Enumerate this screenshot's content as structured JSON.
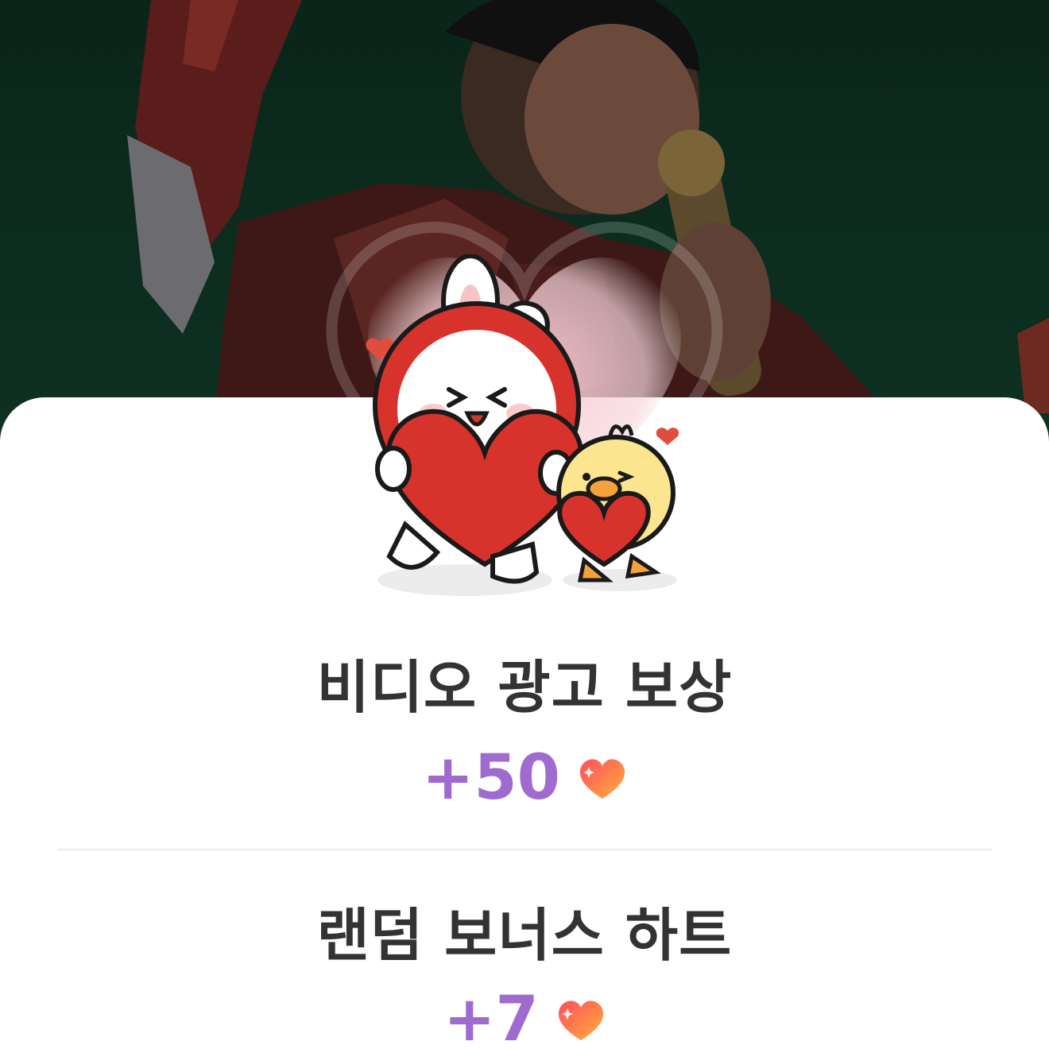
{
  "rewards": [
    {
      "title": "비디오 광고 보상",
      "amount": "+50"
    },
    {
      "title": "랜덤 보너스 하트",
      "amount": "+7"
    }
  ],
  "colors": {
    "accent_purple": "#9f6bcf",
    "title_text": "#333333",
    "background_green": "#0c2a1e",
    "heart_start": "#ff5a5a",
    "heart_end": "#ffab3d"
  },
  "icons": {
    "reward": "heart-icon",
    "illustration": "bunny-and-chick-mascots-icon"
  }
}
